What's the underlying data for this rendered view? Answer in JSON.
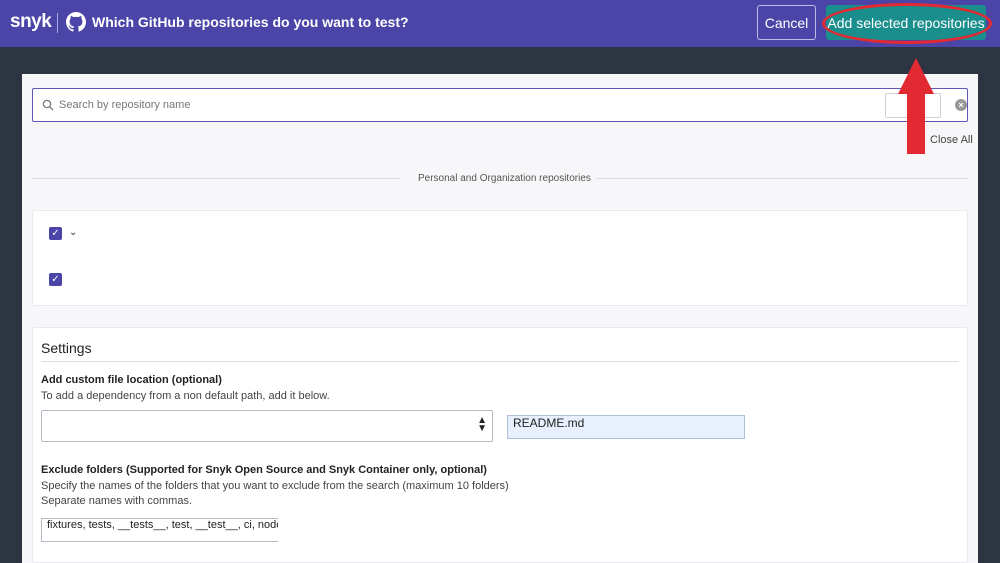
{
  "header": {
    "brand": "snyk",
    "title": "Which GitHub repositories do you want to test?",
    "cancel_label": "Cancel",
    "add_label": "Add selected repositories"
  },
  "search": {
    "placeholder": "Search by repository name"
  },
  "close_all": "Close All",
  "section_divider": "Personal and Organization repositories",
  "repos": [
    {
      "checked": true,
      "expandable": true
    },
    {
      "checked": true,
      "expandable": false
    }
  ],
  "settings": {
    "title": "Settings",
    "custom_location_label": "Add custom file location (optional)",
    "custom_location_help": "To add a dependency from a non default path, add it below.",
    "custom_location_value": "README.md",
    "exclude_label": "Exclude folders (Supported for Snyk Open Source and Snyk Container only, optional)",
    "exclude_help_1": "Specify the names of the folders that you want to exclude from the search (maximum 10 folders)",
    "exclude_help_2": "Separate names with commas.",
    "exclude_value": "fixtures, tests, __tests__, test, __test__, ci, node_mc"
  },
  "colors": {
    "header_bg": "#4b45a8",
    "add_button": "#1a8d8d",
    "annotation_red": "#e32a33"
  }
}
